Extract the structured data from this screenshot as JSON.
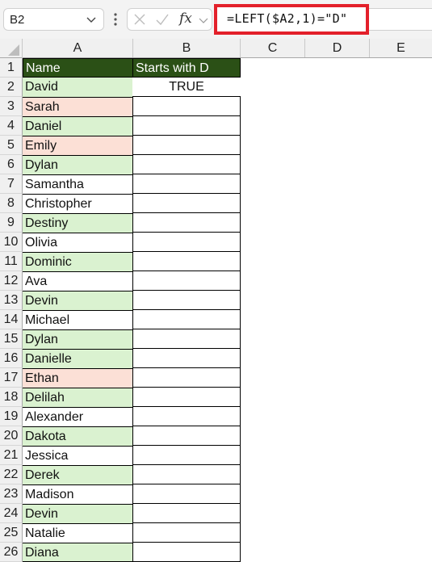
{
  "name_box": {
    "value": "B2"
  },
  "formula_bar": {
    "cancel_icon": "x-icon",
    "enter_icon": "check-icon",
    "function_icon": "fx-icon",
    "formula": "=LEFT($A2,1)=\"D\"",
    "highlight_color": "#e3202a"
  },
  "columns": [
    "A",
    "B",
    "C",
    "D",
    "E"
  ],
  "colors": {
    "header_fill": "#2b5016",
    "header_text": "#ffffff",
    "match_fill": "#daf2d0",
    "highlight_fill": "#fce0d6"
  },
  "rows": [
    {
      "num": "1",
      "a": "Name",
      "b": "Starts with D",
      "style": "hdr"
    },
    {
      "num": "2",
      "a": "David",
      "b": "TRUE",
      "style": "green"
    },
    {
      "num": "3",
      "a": "Sarah",
      "b": "",
      "style": "peach"
    },
    {
      "num": "4",
      "a": "Daniel",
      "b": "",
      "style": "green"
    },
    {
      "num": "5",
      "a": "Emily",
      "b": "",
      "style": "peach"
    },
    {
      "num": "6",
      "a": "Dylan",
      "b": "",
      "style": "green"
    },
    {
      "num": "7",
      "a": "Samantha",
      "b": "",
      "style": "white"
    },
    {
      "num": "8",
      "a": "Christopher",
      "b": "",
      "style": "white"
    },
    {
      "num": "9",
      "a": "Destiny",
      "b": "",
      "style": "green"
    },
    {
      "num": "10",
      "a": "Olivia",
      "b": "",
      "style": "white"
    },
    {
      "num": "11",
      "a": "Dominic",
      "b": "",
      "style": "green"
    },
    {
      "num": "12",
      "a": "Ava",
      "b": "",
      "style": "white"
    },
    {
      "num": "13",
      "a": "Devin",
      "b": "",
      "style": "green"
    },
    {
      "num": "14",
      "a": "Michael",
      "b": "",
      "style": "white"
    },
    {
      "num": "15",
      "a": "Dylan",
      "b": "",
      "style": "green"
    },
    {
      "num": "16",
      "a": "Danielle",
      "b": "",
      "style": "green"
    },
    {
      "num": "17",
      "a": "Ethan",
      "b": "",
      "style": "peach"
    },
    {
      "num": "18",
      "a": "Delilah",
      "b": "",
      "style": "green"
    },
    {
      "num": "19",
      "a": "Alexander",
      "b": "",
      "style": "white"
    },
    {
      "num": "20",
      "a": "Dakota",
      "b": "",
      "style": "green"
    },
    {
      "num": "21",
      "a": "Jessica",
      "b": "",
      "style": "white"
    },
    {
      "num": "22",
      "a": "Derek",
      "b": "",
      "style": "green"
    },
    {
      "num": "23",
      "a": "Madison",
      "b": "",
      "style": "white"
    },
    {
      "num": "24",
      "a": "Devin",
      "b": "",
      "style": "green"
    },
    {
      "num": "25",
      "a": "Natalie",
      "b": "",
      "style": "white"
    },
    {
      "num": "26",
      "a": "Diana",
      "b": "",
      "style": "green"
    }
  ]
}
